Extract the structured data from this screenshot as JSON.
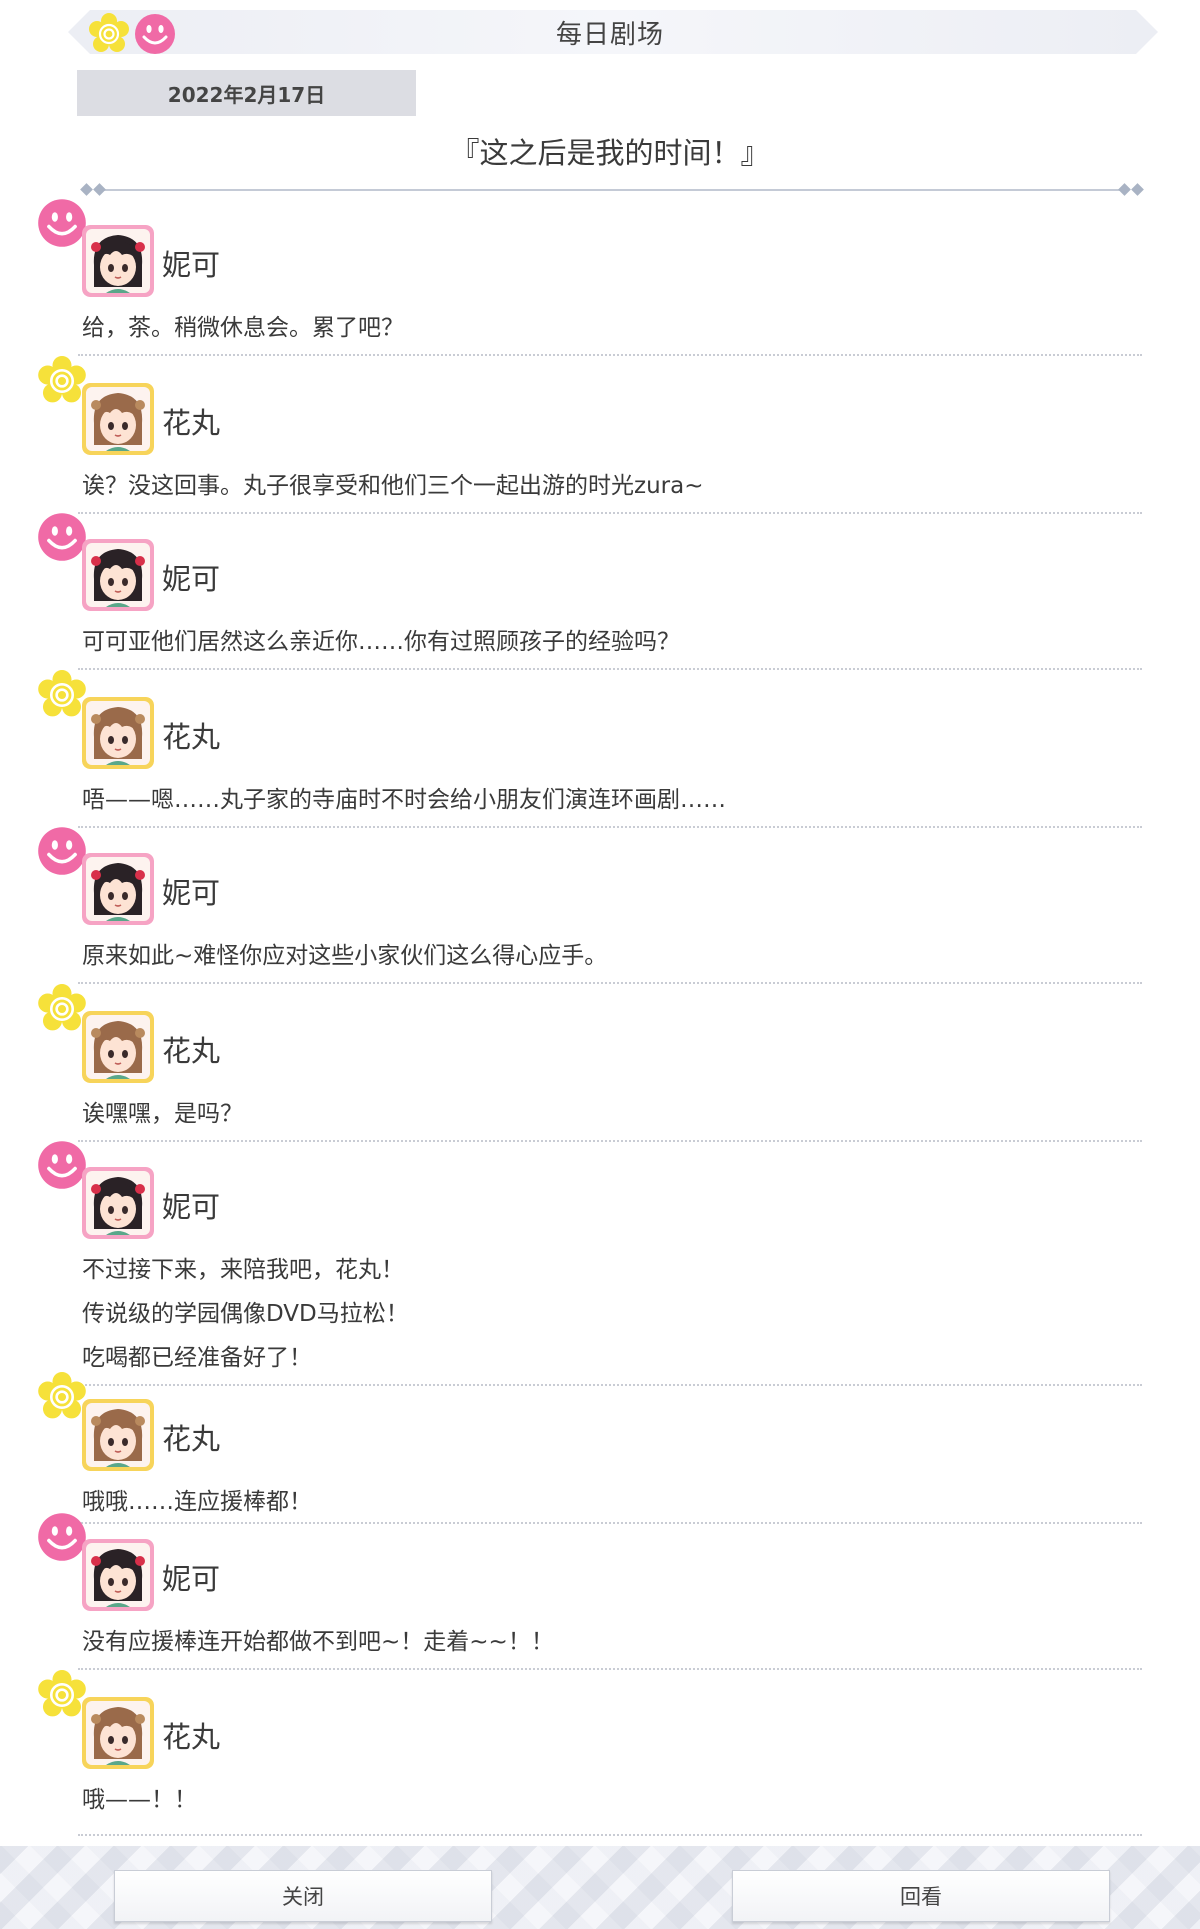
{
  "header": {
    "title": "每日剧场",
    "date": "2022年2月17日"
  },
  "story": {
    "title": "『这之后是我的时间！』"
  },
  "characters": {
    "nico": {
      "name": "妮可",
      "emblem": "smiley-icon",
      "emblem_color": "#f06aa6",
      "frame_color": "#f6a3c4",
      "hair_color": "#2a2226",
      "ribbon_color": "#d8304a"
    },
    "hanamaru": {
      "name": "花丸",
      "emblem": "flower-icon",
      "emblem_color": "#f6e13a",
      "frame_color": "#f7d45a",
      "hair_color": "#9a6a4a",
      "ribbon_color": "#b98a5e"
    }
  },
  "dialogue": [
    {
      "speaker": "nico",
      "lines": [
        "给，茶。稍微休息会。累了吧？"
      ]
    },
    {
      "speaker": "hanamaru",
      "lines": [
        "诶？没这回事。丸子很享受和他们三个一起出游的时光zura~"
      ]
    },
    {
      "speaker": "nico",
      "lines": [
        "可可亚他们居然这么亲近你……你有过照顾孩子的经验吗？"
      ]
    },
    {
      "speaker": "hanamaru",
      "lines": [
        "唔——嗯……丸子家的寺庙时不时会给小朋友们演连环画剧……"
      ]
    },
    {
      "speaker": "nico",
      "lines": [
        "原来如此~难怪你应对这些小家伙们这么得心应手。"
      ]
    },
    {
      "speaker": "hanamaru",
      "lines": [
        "诶嘿嘿，是吗？"
      ]
    },
    {
      "speaker": "nico",
      "lines": [
        "不过接下来，来陪我吧，花丸！",
        "传说级的学园偶像DVD马拉松！",
        "吃喝都已经准备好了！"
      ]
    },
    {
      "speaker": "hanamaru",
      "lines": [
        "哦哦……连应援棒都！"
      ]
    },
    {
      "speaker": "nico",
      "lines": [
        "没有应援棒连开始都做不到吧~！走着~~！！"
      ]
    },
    {
      "speaker": "hanamaru",
      "lines": [
        "哦——！！"
      ]
    }
  ],
  "footer": {
    "close_label": "关闭",
    "review_label": "回看"
  }
}
